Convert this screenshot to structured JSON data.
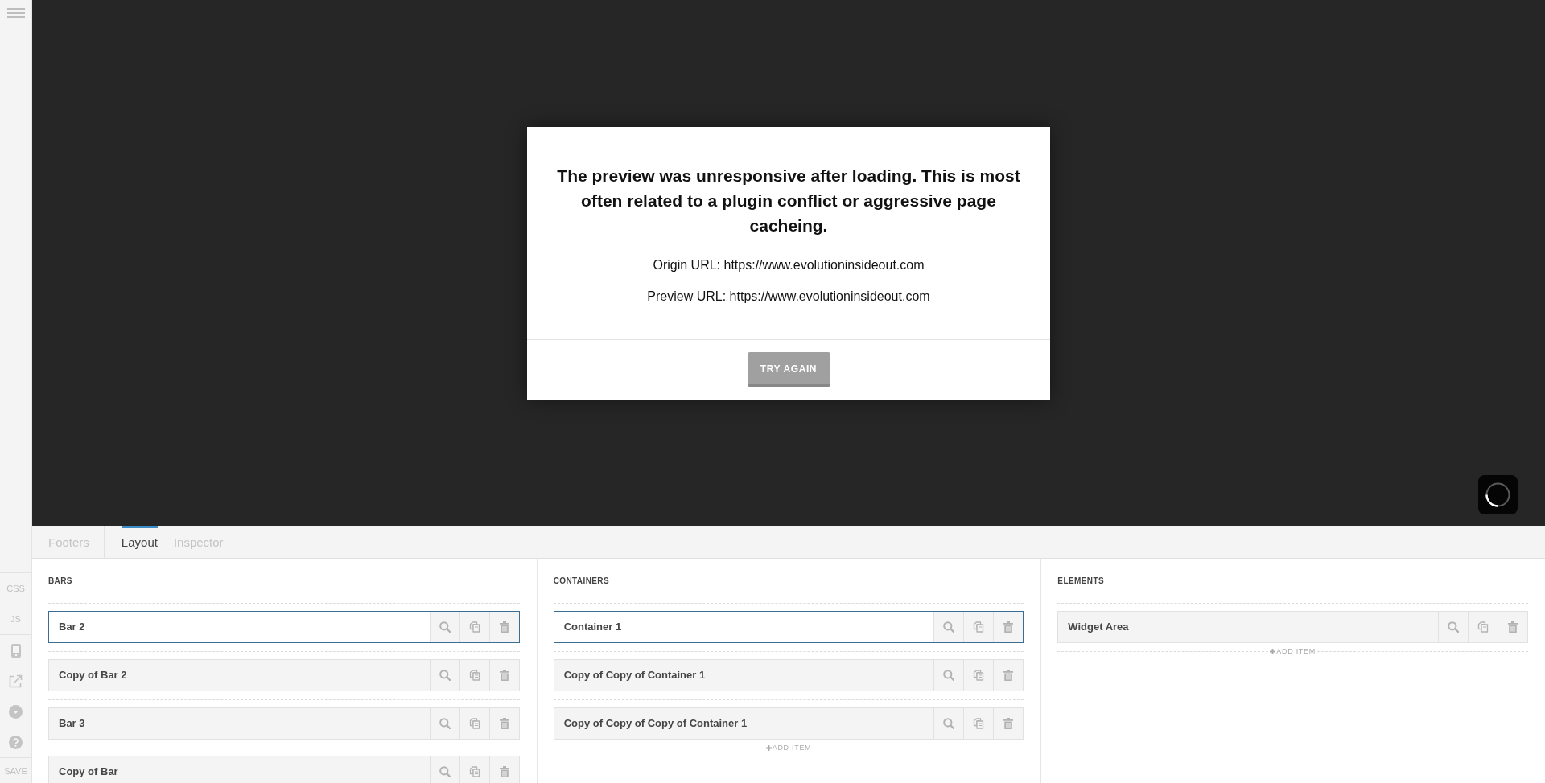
{
  "sidebar": {
    "code_buttons": [
      "CSS",
      "JS"
    ],
    "save_label": "SAVE"
  },
  "preview": {
    "loading": true,
    "dialog": {
      "message": "The preview was unresponsive after loading. This is most often related to a plugin conflict or aggressive page cacheing.",
      "origin_url": "Origin URL: https://www.evolutioninsideout.com",
      "preview_url": "Preview URL: https://www.evolutioninsideout.com",
      "button": "TRY AGAIN"
    }
  },
  "panel": {
    "context": "Footers",
    "tabs": [
      {
        "label": "Layout",
        "selected": true
      },
      {
        "label": "Inspector",
        "selected": false
      }
    ],
    "columns": [
      {
        "title": "BARS",
        "items": [
          {
            "label": "Bar 2",
            "selected": true
          },
          {
            "label": "Copy of Bar 2",
            "selected": false
          },
          {
            "label": "Bar 3",
            "selected": false
          },
          {
            "label": "Copy of Bar",
            "selected": false
          }
        ]
      },
      {
        "title": "CONTAINERS",
        "items": [
          {
            "label": "Container 1",
            "selected": true
          },
          {
            "label": "Copy of Copy of Container 1",
            "selected": false
          },
          {
            "label": "Copy of Copy of Copy of Container 1",
            "selected": false
          }
        ],
        "add_item": "ADD ITEM"
      },
      {
        "title": "ELEMENTS",
        "items": [
          {
            "label": "Widget Area",
            "selected": false
          }
        ],
        "add_item": "ADD ITEM"
      }
    ]
  }
}
